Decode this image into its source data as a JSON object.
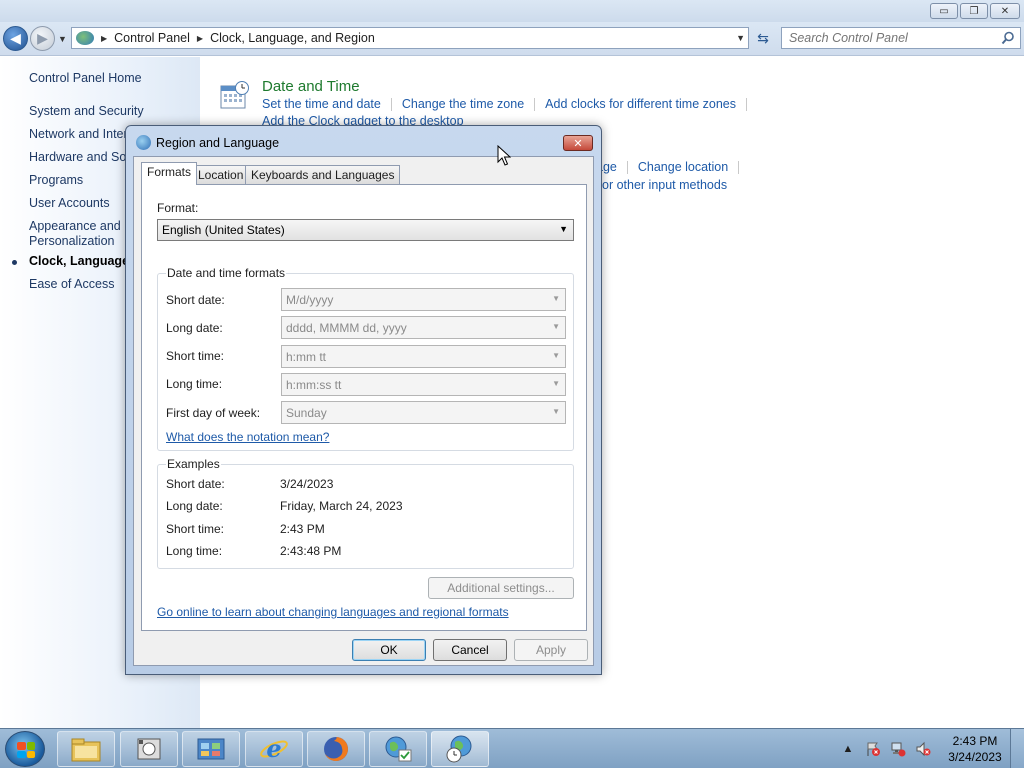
{
  "explorer": {
    "address_crumbs": [
      "Control Panel",
      "Clock, Language, and Region"
    ],
    "search_placeholder": "Search Control Panel",
    "window_buttons": {
      "minimize": "▭",
      "maximize": "❐",
      "close": "✕"
    }
  },
  "sidebar": {
    "items": [
      {
        "label": "Control Panel Home"
      },
      {
        "label": "System and Security"
      },
      {
        "label": "Network and Inter"
      },
      {
        "label": "Hardware and Sou"
      },
      {
        "label": "Programs"
      },
      {
        "label": "User Accounts"
      },
      {
        "label": "Appearance and"
      },
      {
        "label": "Personalization"
      },
      {
        "label": "Clock, Language, a"
      },
      {
        "label": "Ease of Access"
      }
    ]
  },
  "main": {
    "category_title": "Date and Time",
    "links_row1": [
      "Set the time and date",
      "Change the time zone",
      "Add clocks for different time zones"
    ],
    "links_row2": [
      "Add the Clock gadget to the desktop"
    ],
    "region_links_visible": [
      "age",
      "Change location"
    ],
    "region_link_row2": "or other input methods"
  },
  "dialog": {
    "title": "Region and Language",
    "close_label": "✕",
    "tabs": [
      "Formats",
      "Location",
      "Keyboards and Languages"
    ],
    "format_label": "Format:",
    "format_value": "English (United States)",
    "date_time_group": "Date and time formats",
    "formats": [
      {
        "label": "Short date:",
        "value": "M/d/yyyy"
      },
      {
        "label": "Long date:",
        "value": "dddd, MMMM dd, yyyy"
      },
      {
        "label": "Short time:",
        "value": "h:mm tt"
      },
      {
        "label": "Long time:",
        "value": "h:mm:ss tt"
      },
      {
        "label": "First day of week:",
        "value": "Sunday"
      }
    ],
    "notation_link": "What does the notation mean?",
    "examples_group": "Examples",
    "examples": [
      {
        "label": "Short date:",
        "value": "3/24/2023"
      },
      {
        "label": "Long date:",
        "value": "Friday, March 24, 2023"
      },
      {
        "label": "Short time:",
        "value": "2:43 PM"
      },
      {
        "label": "Long time:",
        "value": "2:43:48 PM"
      }
    ],
    "additional_settings": "Additional settings...",
    "online_link": "Go online to learn about changing languages and regional formats",
    "ok": "OK",
    "cancel": "Cancel",
    "apply": "Apply"
  },
  "taskbar": {
    "time": "2:43 PM",
    "date": "3/24/2023"
  }
}
